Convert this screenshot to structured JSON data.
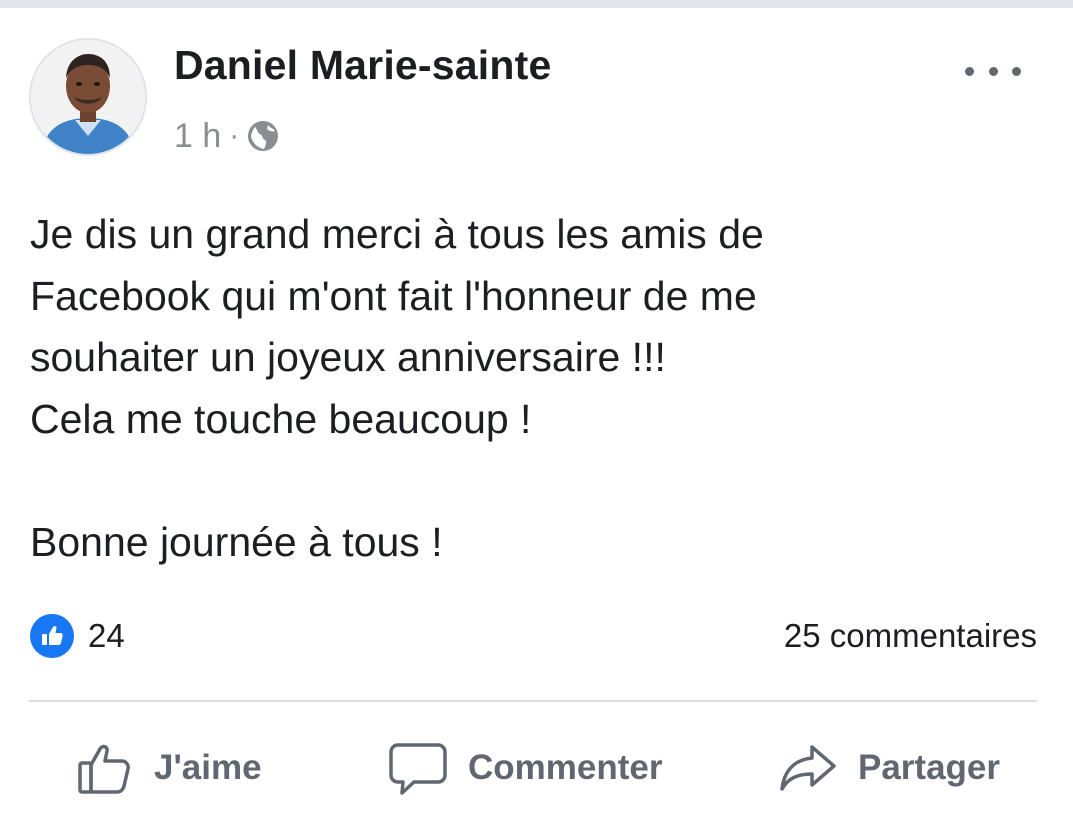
{
  "post": {
    "author": "Daniel Marie-sainte",
    "time": "1 h",
    "separator": "·",
    "privacy_icon": "globe-icon",
    "body_lines": [
      "Je dis un grand merci à tous les amis de",
      "Facebook qui m'ont fait l'honneur de me",
      "souhaiter un joyeux anniversaire !!!",
      "Cela me touche beaucoup !",
      "",
      "Bonne journée à tous !"
    ]
  },
  "stats": {
    "likes": "24",
    "comments": "25 commentaires"
  },
  "actions": {
    "like_label": "J'aime",
    "comment_label": "Commenter",
    "share_label": "Partager"
  },
  "colors": {
    "like_blue": "#1877f2",
    "text": "#1c1e21",
    "muted": "#606770",
    "divider": "#dcdfe3"
  }
}
